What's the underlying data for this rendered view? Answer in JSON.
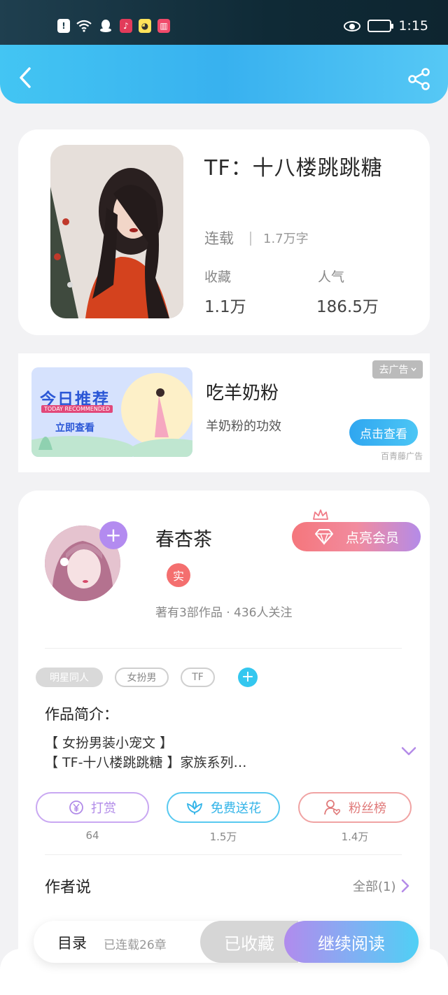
{
  "status_bar": {
    "time": "1:15",
    "notification_icons": [
      "alert-icon",
      "wifi-icon",
      "qq-icon",
      "music-app-icon",
      "bird-app-icon",
      "book-app-icon"
    ],
    "visibility_icon": "eye-icon",
    "battery_icon": "battery-icon"
  },
  "header": {
    "back_icon": "back-arrow-icon",
    "share_icon": "share-icon"
  },
  "book": {
    "title": "TF：十八楼跳跳糖",
    "status": "连载",
    "word_count": "1.7万字",
    "favorites_label": "收藏",
    "favorites_value": "1.1万",
    "popularity_label": "人气",
    "popularity_value": "186.5万"
  },
  "ad": {
    "banner_title": "今日推荐",
    "banner_subtitle": "TODAY RECOMMENDED",
    "banner_button": "立即查看",
    "title": "吃羊奶粉",
    "subtitle": "羊奶粉的功效",
    "close_label": "去广告",
    "cta": "点击查看",
    "source": "百青藤广告"
  },
  "author": {
    "name": "春杏茶",
    "real_badge": "实",
    "meta": "著有3部作品 · 436人关注",
    "vip_button": "点亮会员"
  },
  "tags": [
    "明星同人",
    "女扮男",
    "TF"
  ],
  "intro": {
    "title": "作品简介：",
    "line1": "【 女扮男装小宠文 】",
    "line2": "【 TF-十八楼跳跳糖 】家族系列…"
  },
  "actions": {
    "tip_label": "打赏",
    "tip_count": "64",
    "flower_label": "免费送花",
    "flower_count": "1.5万",
    "fans_label": "粉丝榜",
    "fans_count": "1.4万"
  },
  "author_says": {
    "title": "作者说",
    "all_label": "全部(1)"
  },
  "bottom_bar": {
    "catalog": "目录",
    "chapters": "已连载26章",
    "collected": "已收藏",
    "continue": "继续阅读"
  },
  "colors": {
    "header_blue": "#38b1ef",
    "vip_pink": "#f4767c",
    "tip_purple": "#b18be8",
    "flower_blue": "#33b4e8",
    "fans_red": "#e07a7a"
  }
}
